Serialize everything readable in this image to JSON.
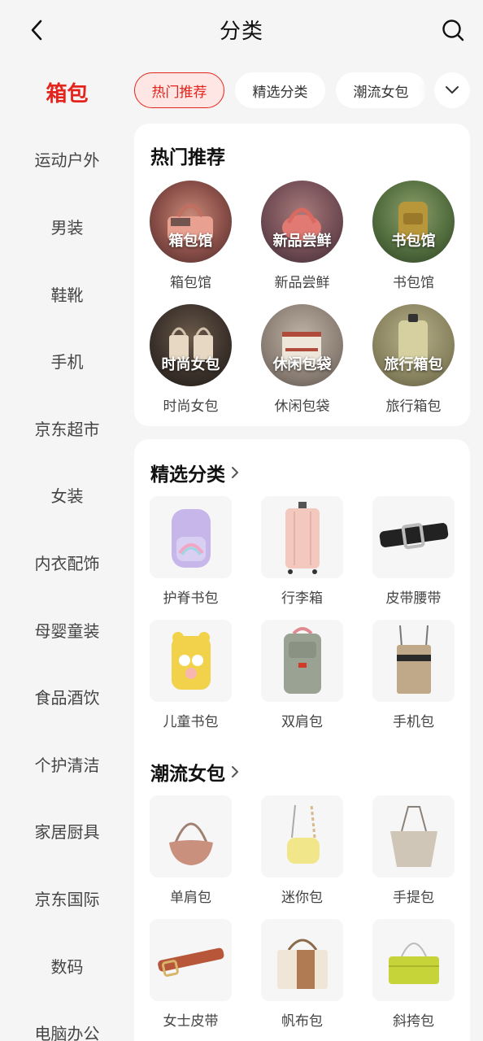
{
  "header": {
    "title": "分类"
  },
  "sidebar": {
    "items": [
      {
        "label": "箱包",
        "active": true
      },
      {
        "label": "运动户外"
      },
      {
        "label": "男装"
      },
      {
        "label": "鞋靴"
      },
      {
        "label": "手机"
      },
      {
        "label": "京东超市"
      },
      {
        "label": "女装"
      },
      {
        "label": "内衣配饰"
      },
      {
        "label": "母婴童装"
      },
      {
        "label": "食品酒饮"
      },
      {
        "label": "个护清洁"
      },
      {
        "label": "家居厨具"
      },
      {
        "label": "京东国际"
      },
      {
        "label": "数码"
      },
      {
        "label": "电脑办公"
      }
    ]
  },
  "chips": [
    {
      "label": "热门推荐",
      "active": true
    },
    {
      "label": "精选分类"
    },
    {
      "label": "潮流女包"
    }
  ],
  "hot": {
    "title": "热门推荐",
    "items": [
      {
        "overlay": "箱包馆",
        "label": "箱包馆"
      },
      {
        "overlay": "新品尝鲜",
        "label": "新品尝鲜"
      },
      {
        "overlay": "书包馆",
        "label": "书包馆"
      },
      {
        "overlay": "时尚女包",
        "label": "时尚女包"
      },
      {
        "overlay": "休闲包袋",
        "label": "休闲包袋"
      },
      {
        "overlay": "旅行箱包",
        "label": "旅行箱包"
      }
    ]
  },
  "selected": {
    "title": "精选分类",
    "items": [
      {
        "label": "护脊书包"
      },
      {
        "label": "行李箱"
      },
      {
        "label": "皮带腰带"
      },
      {
        "label": "儿童书包"
      },
      {
        "label": "双肩包"
      },
      {
        "label": "手机包"
      }
    ]
  },
  "trend": {
    "title": "潮流女包",
    "items": [
      {
        "label": "单肩包"
      },
      {
        "label": "迷你包"
      },
      {
        "label": "手提包"
      },
      {
        "label": "女士皮带"
      },
      {
        "label": "帆布包"
      },
      {
        "label": "斜挎包"
      }
    ]
  },
  "colors": {
    "accent": "#e4231c",
    "page_bg": "#f5f5f5"
  }
}
